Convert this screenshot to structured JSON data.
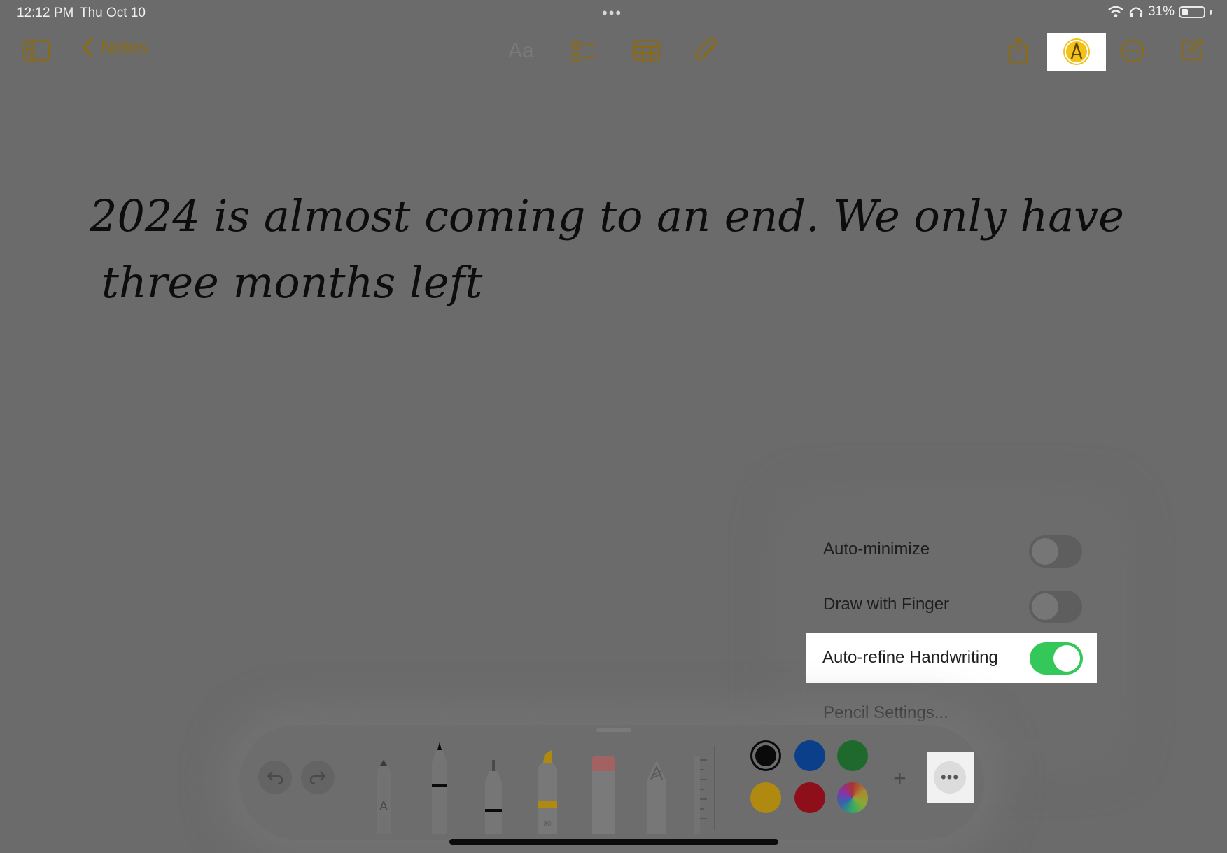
{
  "status_bar": {
    "time": "12:12 PM",
    "date": "Thu Oct 10",
    "battery": "31%",
    "battery_level": 0.31
  },
  "toolbar": {
    "back_label": "Notes",
    "format_label": "Aa",
    "icons": [
      "sidebar-icon",
      "checklist-icon",
      "table-icon",
      "attachment-icon",
      "share-icon",
      "markup-icon",
      "more-icon",
      "compose-icon"
    ]
  },
  "note": {
    "line1": "2024 is almost coming to an end. We only have",
    "line2": "three months left"
  },
  "menu": {
    "items": [
      {
        "label": "Auto-minimize",
        "toggle": false
      },
      {
        "label": "Draw with Finger",
        "toggle": false
      },
      {
        "label": "Auto-refine Handwriting",
        "toggle": true
      },
      {
        "label": "Pencil Settings..."
      }
    ]
  },
  "palette": {
    "tools": [
      "undo-icon",
      "redo-icon",
      "monoline-pen",
      "pen",
      "fineliner",
      "highlighter",
      "eraser",
      "pencil",
      "ruler"
    ],
    "colors": [
      "#0a0a0a",
      "#0c3f8a",
      "#1d6a2c",
      "#b08a10",
      "#8e0e1a",
      "color-wheel"
    ],
    "more_label": "•••",
    "add_label": "+"
  },
  "accent": "#a57e15"
}
